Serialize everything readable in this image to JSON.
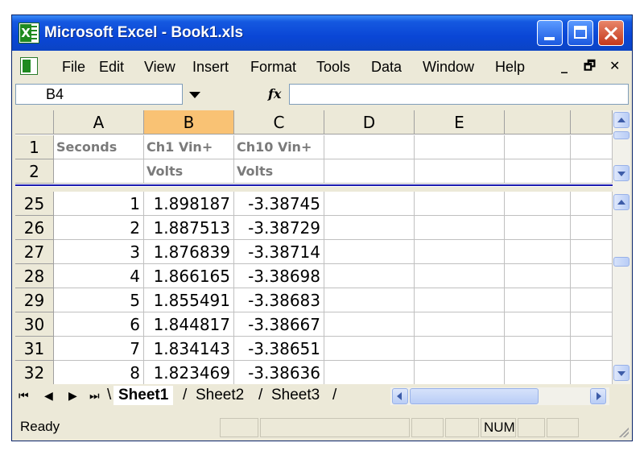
{
  "window": {
    "title": "Microsoft Excel - Book1.xls"
  },
  "menu": [
    "File",
    "Edit",
    "View",
    "Insert",
    "Format",
    "Tools",
    "Data",
    "Window",
    "Help"
  ],
  "formula_bar": {
    "name_box": "B4",
    "fx_label": "fx",
    "formula": ""
  },
  "columns": [
    "A",
    "B",
    "C",
    "D",
    "E"
  ],
  "selected_column": "B",
  "frozen_rows": [
    {
      "row": "1",
      "cells": [
        "Seconds",
        "Ch1 Vin+",
        "Ch10 Vin+",
        "",
        ""
      ]
    },
    {
      "row": "2",
      "cells": [
        "",
        "Volts",
        "Volts",
        "",
        ""
      ]
    }
  ],
  "data_rows": [
    {
      "row": "25",
      "cells": [
        "1",
        "1.898187",
        "-3.38745",
        "",
        ""
      ]
    },
    {
      "row": "26",
      "cells": [
        "2",
        "1.887513",
        "-3.38729",
        "",
        ""
      ]
    },
    {
      "row": "27",
      "cells": [
        "3",
        "1.876839",
        "-3.38714",
        "",
        ""
      ]
    },
    {
      "row": "28",
      "cells": [
        "4",
        "1.866165",
        "-3.38698",
        "",
        ""
      ]
    },
    {
      "row": "29",
      "cells": [
        "5",
        "1.855491",
        "-3.38683",
        "",
        ""
      ]
    },
    {
      "row": "30",
      "cells": [
        "6",
        "1.844817",
        "-3.38667",
        "",
        ""
      ]
    },
    {
      "row": "31",
      "cells": [
        "7",
        "1.834143",
        "-3.38651",
        "",
        ""
      ]
    },
    {
      "row": "32",
      "cells": [
        "8",
        "1.823469",
        "-3.38636",
        "",
        ""
      ]
    }
  ],
  "sheets": {
    "tabs": [
      "Sheet1",
      "Sheet2",
      "Sheet3"
    ],
    "active": "Sheet1"
  },
  "status": {
    "text": "Ready",
    "num": "NUM"
  },
  "colors": {
    "title_bar": "#0a46d6",
    "selected_header": "#f9c274",
    "freeze_line": "#1c1cb0"
  }
}
